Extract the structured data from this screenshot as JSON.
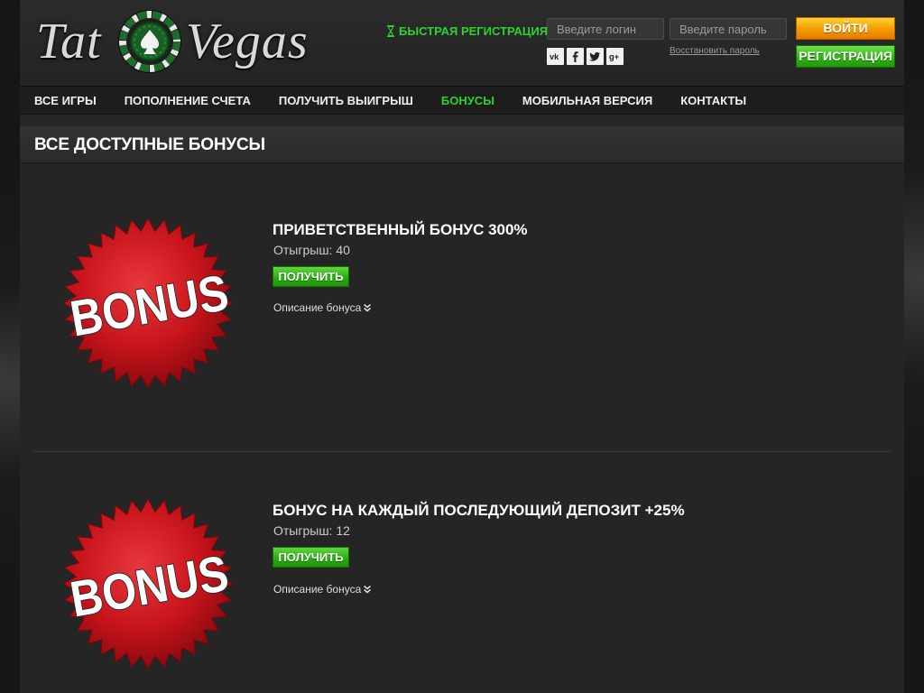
{
  "header": {
    "logo_left": "Tat",
    "logo_right": "Vegas",
    "fast_registration": "БЫСТРАЯ РЕГИСТРАЦИЯ",
    "login_placeholder": "Введите логин",
    "password_placeholder": "Введите пароль",
    "restore_password": "Восстановить пароль",
    "login_button": "ВОЙТИ",
    "register_button": "РЕГИСТРАЦИЯ",
    "socials": [
      "vk-icon",
      "facebook-icon",
      "twitter-icon",
      "google-plus-icon"
    ]
  },
  "nav": {
    "items": [
      {
        "label": "ВСЕ ИГРЫ"
      },
      {
        "label": "ПОПОЛНЕНИЕ СЧЕТА"
      },
      {
        "label": "ПОЛУЧИТЬ ВЫИГРЫШ"
      },
      {
        "label": "БОНУСЫ",
        "active": true
      },
      {
        "label": "МОБИЛЬНАЯ ВЕРСИЯ"
      },
      {
        "label": "КОНТАКТЫ"
      }
    ]
  },
  "page": {
    "title": "ВСЕ ДОСТУПНЫЕ БОНУСЫ"
  },
  "bonuses": [
    {
      "image_text": "BONUS",
      "title": "ПРИВЕТСТВЕННЫЙ БОНУС 300%",
      "wager": "Отыгрыш: 40",
      "button": "ПОЛУЧИТЬ",
      "description_link": "Описание бонуса"
    },
    {
      "image_text": "BONUS",
      "title": "БОНУС НА КАЖДЫЙ ПОСЛЕДУЮЩИЙ ДЕПОЗИТ +25%",
      "wager": "Отыгрыш: 12",
      "button": "ПОЛУЧИТЬ",
      "description_link": "Описание бонуса"
    }
  ],
  "colors": {
    "accent_green": "#2ed12e",
    "login_orange": "#f39a00",
    "register_green": "#2fb315",
    "bonus_red": "#c8141b"
  }
}
